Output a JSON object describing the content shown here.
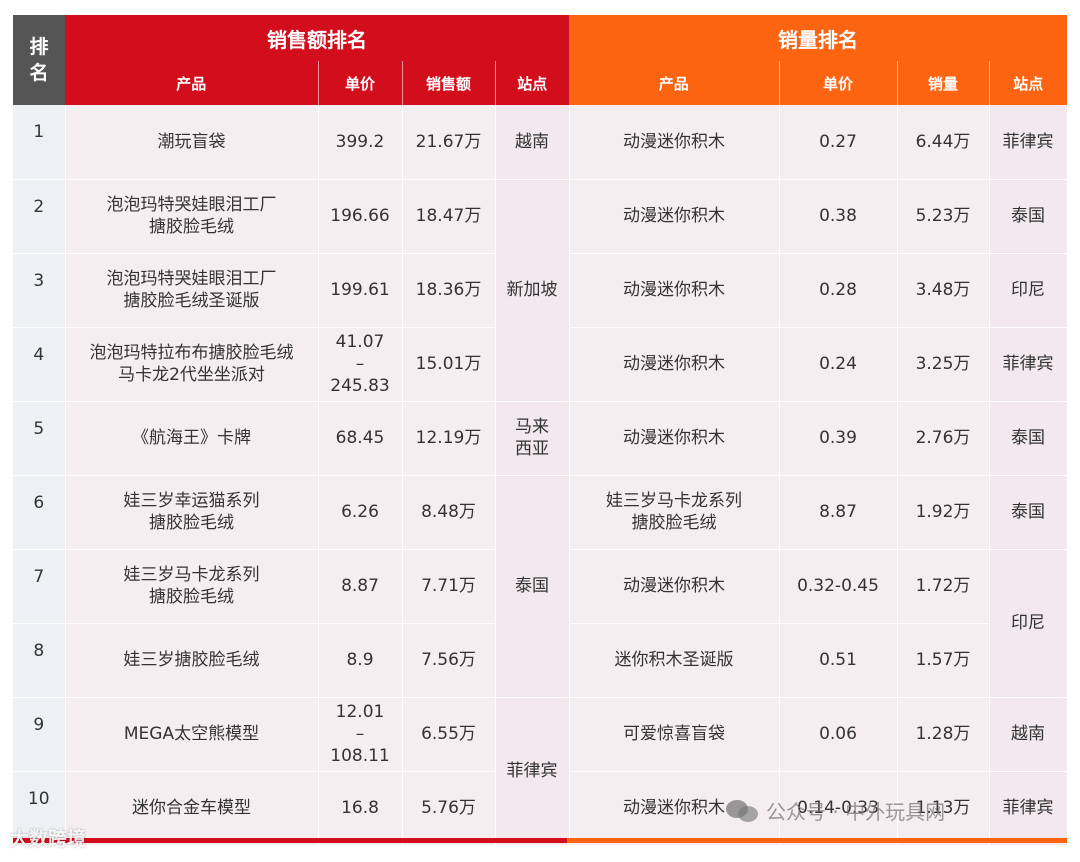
{
  "header": {
    "rank": "排名",
    "sales_amount_title": "销售额排名",
    "sales_volume_title": "销量排名",
    "left_cols": [
      "产品",
      "单价",
      "销售额",
      "站点"
    ],
    "right_cols": [
      "产品",
      "单价",
      "销量",
      "站点"
    ]
  },
  "rows": [
    {
      "rank": "1",
      "lp": "潮玩盲袋",
      "lpr": "399.2",
      "ls": "21.67万",
      "rp": "动漫迷你积木",
      "rpr": "0.27",
      "rv": "6.44万",
      "rsite": "菲律宾"
    },
    {
      "rank": "2",
      "lp": "泡泡玛特哭娃眼泪工厂\n搪胶脸毛绒",
      "lpr": "196.66",
      "ls": "18.47万",
      "rp": "动漫迷你积木",
      "rpr": "0.38",
      "rv": "5.23万",
      "rsite": "泰国"
    },
    {
      "rank": "3",
      "lp": "泡泡玛特哭娃眼泪工厂\n搪胶脸毛绒圣诞版",
      "lpr": "199.61",
      "ls": "18.36万",
      "rp": "动漫迷你积木",
      "rpr": "0.28",
      "rv": "3.48万",
      "rsite": "印尼"
    },
    {
      "rank": "4",
      "lp": "泡泡玛特拉布布搪胶脸毛绒\n马卡龙2代坐坐派对",
      "lpr": "41.07\n–\n245.83",
      "ls": "15.01万",
      "rp": "动漫迷你积木",
      "rpr": "0.24",
      "rv": "3.25万",
      "rsite": "菲律宾"
    },
    {
      "rank": "5",
      "lp": "《航海王》卡牌",
      "lpr": "68.45",
      "ls": "12.19万",
      "rp": "动漫迷你积木",
      "rpr": "0.39",
      "rv": "2.76万",
      "rsite": "泰国"
    },
    {
      "rank": "6",
      "lp": "娃三岁幸运猫系列\n搪胶脸毛绒",
      "lpr": "6.26",
      "ls": "8.48万",
      "rp": "娃三岁马卡龙系列\n搪胶脸毛绒",
      "rpr": "8.87",
      "rv": "1.92万",
      "rsite": "泰国"
    },
    {
      "rank": "7",
      "lp": "娃三岁马卡龙系列\n搪胶脸毛绒",
      "lpr": "8.87",
      "ls": "7.71万",
      "rp": "动漫迷你积木",
      "rpr": "0.32-0.45",
      "rv": "1.72万",
      "rsite": "印尼"
    },
    {
      "rank": "8",
      "lp": "娃三岁搪胶脸毛绒",
      "lpr": "8.9",
      "ls": "7.56万",
      "rp": "迷你积木圣诞版",
      "rpr": "0.51",
      "rv": "1.57万",
      "rsite": ""
    },
    {
      "rank": "9",
      "lp": "MEGA太空熊模型",
      "lpr": "12.01\n–\n108.11",
      "ls": "6.55万",
      "rp": "可爱惊喜盲袋",
      "rpr": "0.06",
      "rv": "1.28万",
      "rsite": "越南"
    },
    {
      "rank": "10",
      "lp": "迷你合金车模型",
      "lpr": "16.8",
      "ls": "5.76万",
      "rp": "动漫迷你积木",
      "rpr": "0.14-0.33",
      "rv": "1.13万",
      "rsite": "菲律宾"
    }
  ],
  "left_sites": [
    "越南",
    "新加坡",
    "马来\n西亚",
    "泰国",
    "菲律宾"
  ],
  "watermark_left": "大数跨境",
  "watermark_right": "公众号 · 中外玩具网",
  "colors": {
    "red": "#d20d1c",
    "orange": "#fc6411",
    "rank_header": "#555555"
  }
}
